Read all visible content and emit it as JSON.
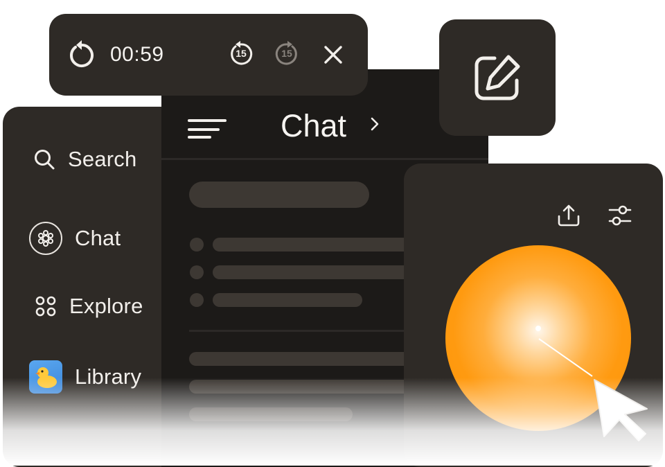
{
  "player": {
    "time": "00:59",
    "rewind_seconds": "15",
    "forward_seconds": "15",
    "icons": [
      "restart-icon",
      "rewind-15-icon",
      "forward-15-icon",
      "close-icon"
    ]
  },
  "compose": {
    "icon": "compose-icon"
  },
  "sidebar": {
    "search_label": "Search",
    "items": [
      {
        "label": "Chat",
        "icon": "chat-logo-icon"
      },
      {
        "label": "Explore",
        "icon": "grid-dots-icon"
      },
      {
        "label": "Library",
        "icon": "library-duck-thumbnail"
      }
    ]
  },
  "chat_panel": {
    "title": "Chat",
    "icons": [
      "menu-icon",
      "chevron-right-icon"
    ]
  },
  "voice_panel": {
    "icons": [
      "share-icon",
      "settings-sliders-icon",
      "orb",
      "pointer-cursor-icon"
    ]
  },
  "colors": {
    "panel": "#2e2a26",
    "chat_bg": "#1c1a18",
    "skeleton": "#3d3833",
    "orb": "#ff9a10",
    "text": "#f2efeb"
  }
}
